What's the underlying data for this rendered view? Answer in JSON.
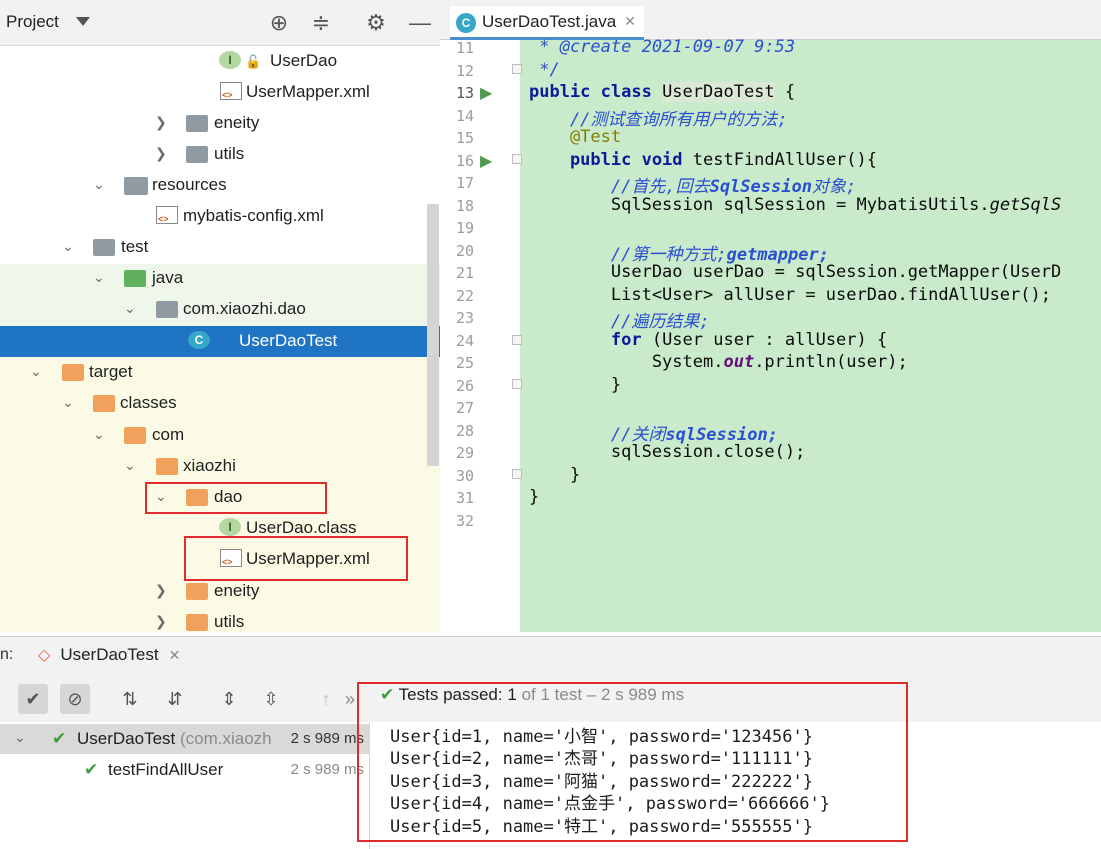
{
  "project_panel": {
    "title": "Project",
    "tree": [
      {
        "label": "UserDao",
        "icon": "interface-icon"
      },
      {
        "label": "UserMapper.xml",
        "icon": "xml-file-icon"
      },
      {
        "label": "eneity",
        "icon": "package-icon"
      },
      {
        "label": "utils",
        "icon": "package-icon"
      },
      {
        "label": "resources",
        "icon": "resources-folder-icon"
      },
      {
        "label": "mybatis-config.xml",
        "icon": "xml-file-icon"
      },
      {
        "label": "test",
        "icon": "folder-icon"
      },
      {
        "label": "java",
        "icon": "test-source-folder-icon"
      },
      {
        "label": "com.xiaozhi.dao",
        "icon": "package-icon"
      },
      {
        "label": "UserDaoTest",
        "icon": "class-icon"
      },
      {
        "label": "target",
        "icon": "excluded-folder-icon"
      },
      {
        "label": "classes",
        "icon": "excluded-folder-icon"
      },
      {
        "label": "com",
        "icon": "excluded-folder-icon"
      },
      {
        "label": "xiaozhi",
        "icon": "excluded-folder-icon"
      },
      {
        "label": "dao",
        "icon": "excluded-folder-icon"
      },
      {
        "label": "UserDao.class",
        "icon": "interface-icon"
      },
      {
        "label": "UserMapper.xml",
        "icon": "xml-file-icon"
      },
      {
        "label": "eneity",
        "icon": "excluded-folder-icon"
      },
      {
        "label": "utils",
        "icon": "excluded-folder-icon"
      }
    ]
  },
  "editor": {
    "tab_label": "UserDaoTest.java",
    "line_numbers": [
      "11",
      "12",
      "13",
      "14",
      "15",
      "16",
      "17",
      "18",
      "19",
      "20",
      "21",
      "22",
      "23",
      "24",
      "25",
      "26",
      "27",
      "28",
      "29",
      "30",
      "31",
      "32"
    ],
    "code": {
      "l11": " * @create 2021-09-07 9:53",
      "l12": " */",
      "l13_kw": "public class ",
      "l13_name": "UserDaoTest",
      "l13_rest": " {",
      "l14": "    //测试查询所有用户的方法;",
      "l15": "    @Test",
      "l16_kw": "    public void ",
      "l16_rest": "testFindAllUser(){",
      "l17_a": "        //首先,回去",
      "l17_b": "SqlSession",
      "l17_c": "对象;",
      "l18_a": "        SqlSession sqlSession = MybatisUtils.",
      "l18_b": "getSqlS",
      "l20_a": "        //第一种方式;",
      "l20_b": "getmapper;",
      "l21": "        UserDao userDao = sqlSession.getMapper(UserD",
      "l22": "        List<User> allUser = userDao.findAllUser();",
      "l23": "        //遍历结果;",
      "l24_kw": "        for ",
      "l24_rest": "(User user : allUser) {",
      "l25_a": "            System.",
      "l25_b": "out",
      "l25_c": ".println(user);",
      "l26": "        }",
      "l28_a": "        //关闭",
      "l28_b": "sqlSession;",
      "l29": "        sqlSession.close();",
      "l30": "    }",
      "l31": "}"
    }
  },
  "run_panel": {
    "prefix": "n:",
    "tab_label": "UserDaoTest",
    "status_prefix": "Tests passed:",
    "status_count": "1",
    "status_rest": "of 1 test – 2 s 989 ms",
    "tests": [
      {
        "name": "UserDaoTest",
        "suffix": "(com.xiaozh",
        "duration": "2 s 989 ms"
      },
      {
        "name": "testFindAllUser",
        "suffix": "",
        "duration": "2 s 989 ms"
      }
    ],
    "output": [
      "User{id=1, name='小智', password='123456'}",
      "User{id=2, name='杰哥', password='111111'}",
      "User{id=3, name='阿猫', password='222222'}",
      "User{id=4, name='点金手', password='666666'}",
      "User{id=5, name='特工', password='555555'}"
    ]
  },
  "colors": {
    "selection": "#1f74c4",
    "code_bg": "#c9ebcb",
    "highlight": "#e02b2b",
    "pass_green": "#3e9c3e"
  }
}
